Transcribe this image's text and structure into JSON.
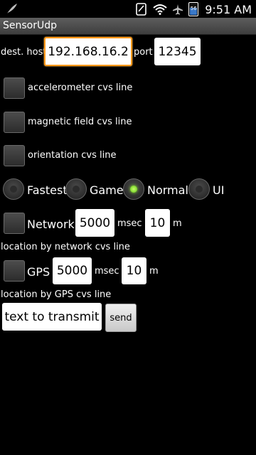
{
  "status_bar": {
    "time": "9:51 AM",
    "battery_level": "56",
    "icons": [
      "feather-icon",
      "notification-icon",
      "wifi-icon",
      "airplane-icon",
      "battery-icon"
    ]
  },
  "app": {
    "title": "SensorUdp"
  },
  "dest": {
    "host_label": "dest. host",
    "host_value": "192.168.16.2",
    "port_label": "port",
    "port_value": "12345"
  },
  "checks": {
    "accelerometer": {
      "label": "accelerometer cvs line",
      "checked": false
    },
    "magnetic": {
      "label": "magnetic field cvs line",
      "checked": false
    },
    "orientation": {
      "label": "orientation cvs line",
      "checked": false
    }
  },
  "rate": {
    "options": [
      "Fastest",
      "Game",
      "Normal",
      "UI"
    ],
    "selected": "Normal"
  },
  "network": {
    "label": "Network",
    "msec_value": "5000",
    "msec_unit": "msec",
    "meters_value": "10",
    "meters_unit": "m",
    "caption": "location by network cvs line"
  },
  "gps": {
    "label": "GPS",
    "msec_value": "5000",
    "msec_unit": "msec",
    "meters_value": "10",
    "meters_unit": "m",
    "caption": "location by GPS cvs line"
  },
  "transmit": {
    "text_value": "text to transmit",
    "send_label": "send"
  },
  "colors": {
    "focus_border": "#ff9a1a",
    "radio_selected": "#8bec2a",
    "title_bar": "#4a4a4a"
  }
}
